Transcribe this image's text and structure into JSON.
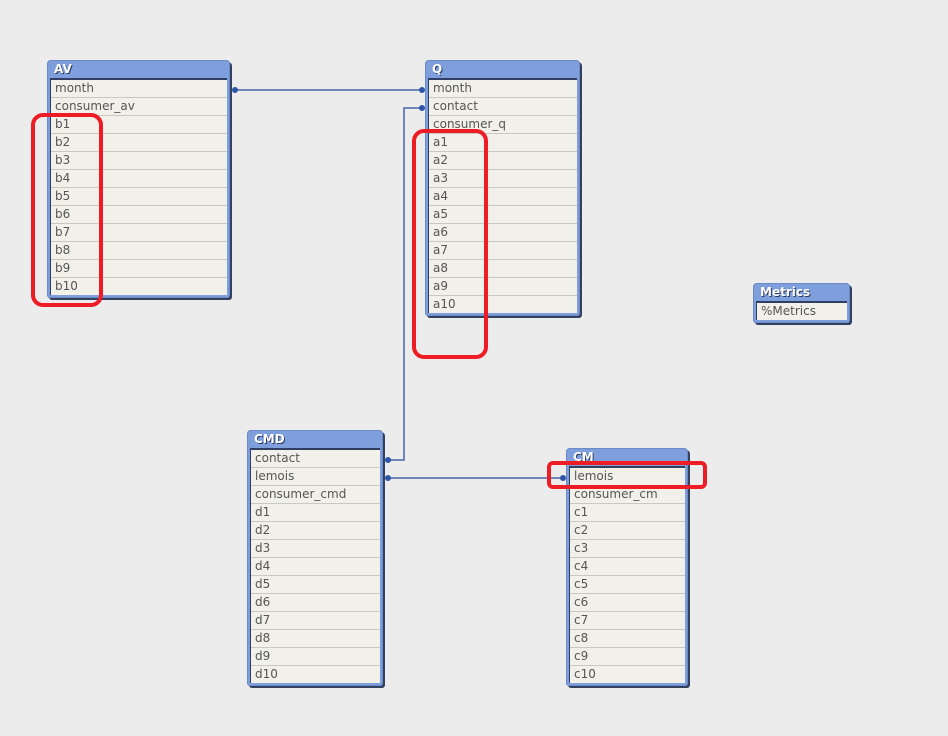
{
  "tables": {
    "av": {
      "title": "AV",
      "fields": [
        "month",
        "consumer_av",
        "b1",
        "b2",
        "b3",
        "b4",
        "b5",
        "b6",
        "b7",
        "b8",
        "b9",
        "b10"
      ]
    },
    "q": {
      "title": "Q",
      "fields": [
        "month",
        "contact",
        "consumer_q",
        "a1",
        "a2",
        "a3",
        "a4",
        "a5",
        "a6",
        "a7",
        "a8",
        "a9",
        "a10"
      ]
    },
    "cmd": {
      "title": "CMD",
      "fields": [
        "contact",
        "lemois",
        "consumer_cmd",
        "d1",
        "d2",
        "d3",
        "d4",
        "d5",
        "d6",
        "d7",
        "d8",
        "d9",
        "d10"
      ]
    },
    "cm": {
      "title": "CM",
      "fields": [
        "lemois",
        "consumer_cm",
        "c1",
        "c2",
        "c3",
        "c4",
        "c5",
        "c6",
        "c7",
        "c8",
        "c9",
        "c10"
      ]
    },
    "metrics": {
      "title": "Metrics",
      "fields": [
        "%Metrics"
      ]
    }
  },
  "links": [
    {
      "from": "AV.month",
      "to": "Q.month"
    },
    {
      "from": "CMD.contact",
      "to": "Q.contact"
    },
    {
      "from": "CMD.lemois",
      "to": "CM.lemois"
    }
  ],
  "colors": {
    "header": "#7f9fdc",
    "field_bg": "#f1f0e9",
    "link": "#6f86b8",
    "highlight": "#ee1c24"
  }
}
